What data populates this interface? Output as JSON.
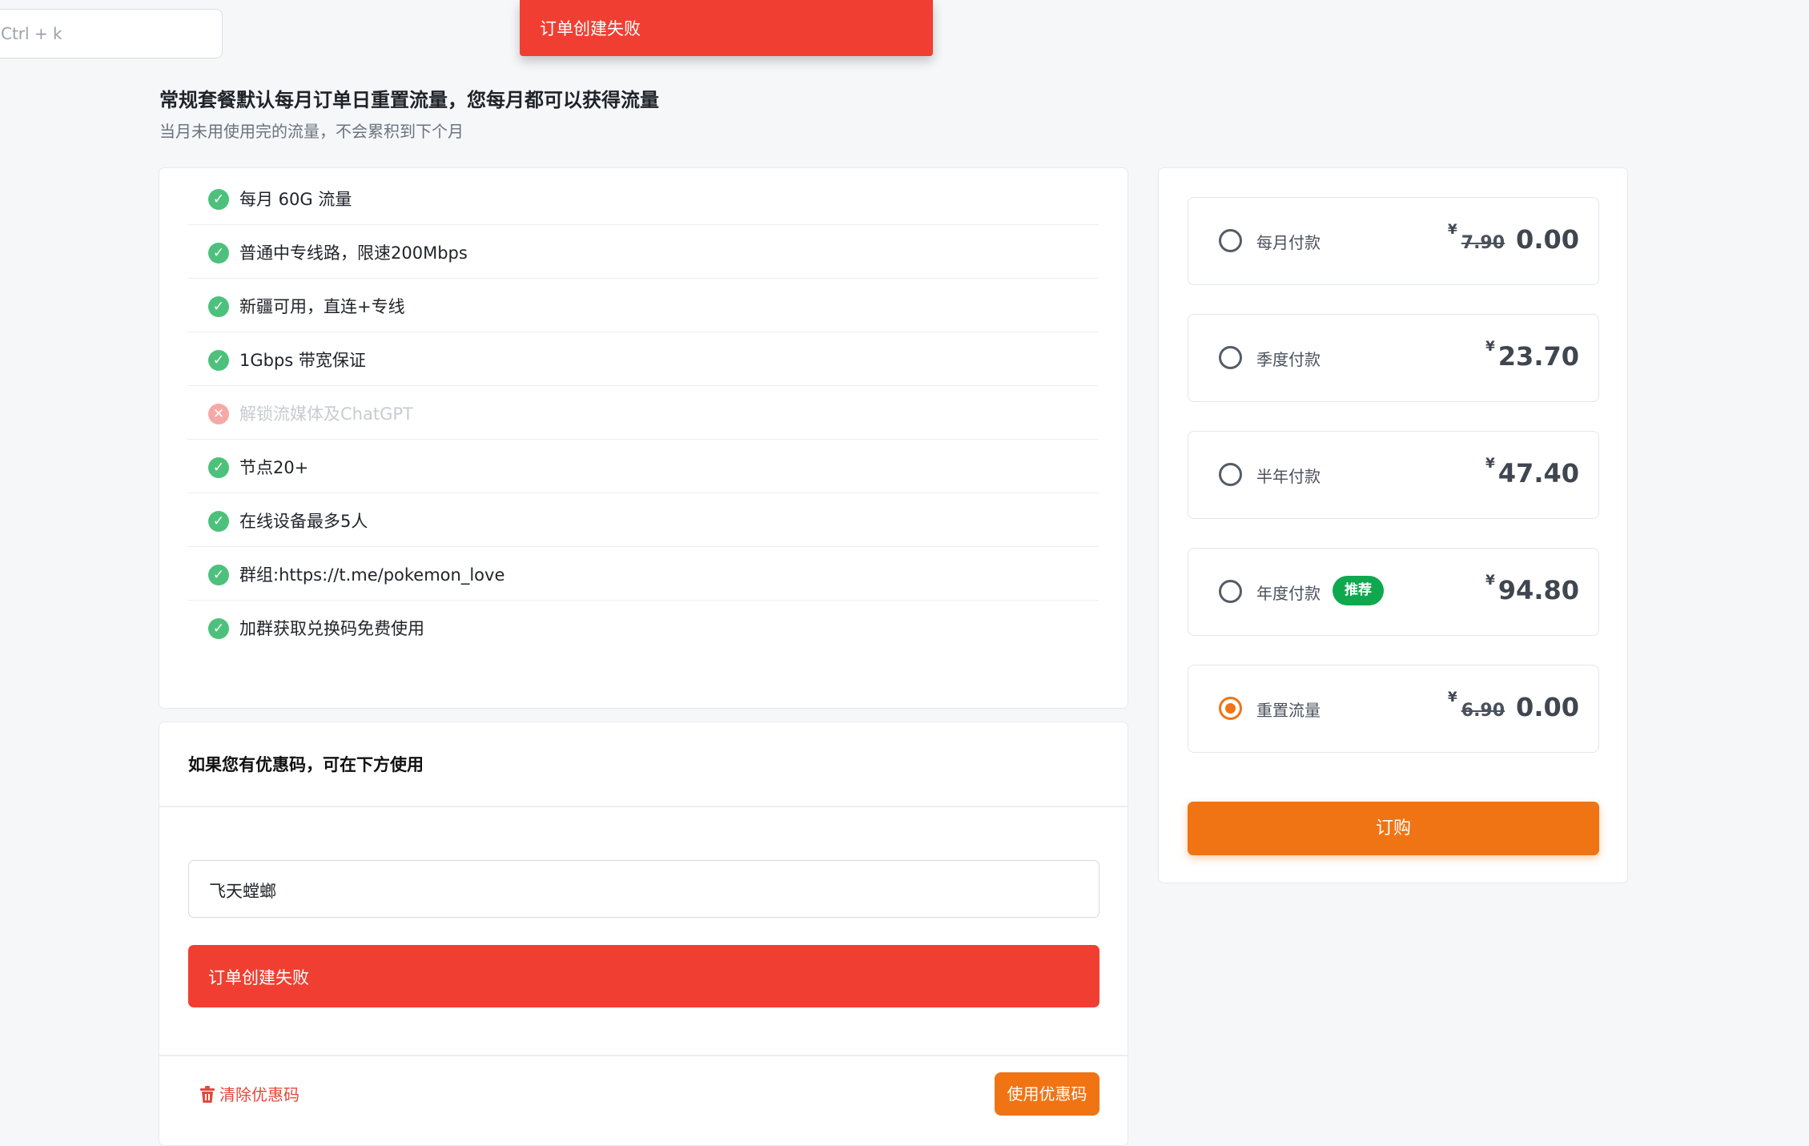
{
  "search": {
    "shortcut_hint": "Ctrl + k"
  },
  "toast": {
    "message": "订单创建失败"
  },
  "heading": {
    "title": "常规套餐默认每月订单日重置流量，您每月都可以获得流量",
    "subtitle": "当月未用使用完的流量，不会累积到下个月"
  },
  "features": [
    {
      "text": "每月 60G 流量",
      "enabled": true
    },
    {
      "text": "普通中专线路，限速200Mbps",
      "enabled": true
    },
    {
      "text": "新疆可用，直连+专线",
      "enabled": true
    },
    {
      "text": "1Gbps 带宽保证",
      "enabled": true
    },
    {
      "text": "解锁流媒体及ChatGPT",
      "enabled": false
    },
    {
      "text": "节点20+",
      "enabled": true
    },
    {
      "text": "在线设备最多5人",
      "enabled": true
    },
    {
      "text": "群组:https://t.me/pokemon_love",
      "enabled": true
    },
    {
      "text": "加群获取兑换码免费使用",
      "enabled": true
    }
  ],
  "coupon": {
    "title": "如果您有优惠码，可在下方使用",
    "input_value": "飞天螳螂",
    "error_message": "订单创建失败",
    "clear_label": "清除优惠码",
    "use_label": "使用优惠码"
  },
  "plans": [
    {
      "label": "每月付款",
      "currency": "¥",
      "old_price": "7.90",
      "price": "0.00",
      "selected": false,
      "badge": ""
    },
    {
      "label": "季度付款",
      "currency": "¥",
      "old_price": "",
      "price": "23.70",
      "selected": false,
      "badge": ""
    },
    {
      "label": "半年付款",
      "currency": "¥",
      "old_price": "",
      "price": "47.40",
      "selected": false,
      "badge": ""
    },
    {
      "label": "年度付款",
      "currency": "¥",
      "old_price": "",
      "price": "94.80",
      "selected": false,
      "badge": "推荐"
    },
    {
      "label": "重置流量",
      "currency": "¥",
      "old_price": "6.90",
      "price": "0.00",
      "selected": true,
      "badge": ""
    }
  ],
  "order_button_label": "订购",
  "colors": {
    "accent": "#f07414",
    "error": "#f03f32",
    "success": "#4dc17c",
    "badge": "#0fa84f"
  }
}
